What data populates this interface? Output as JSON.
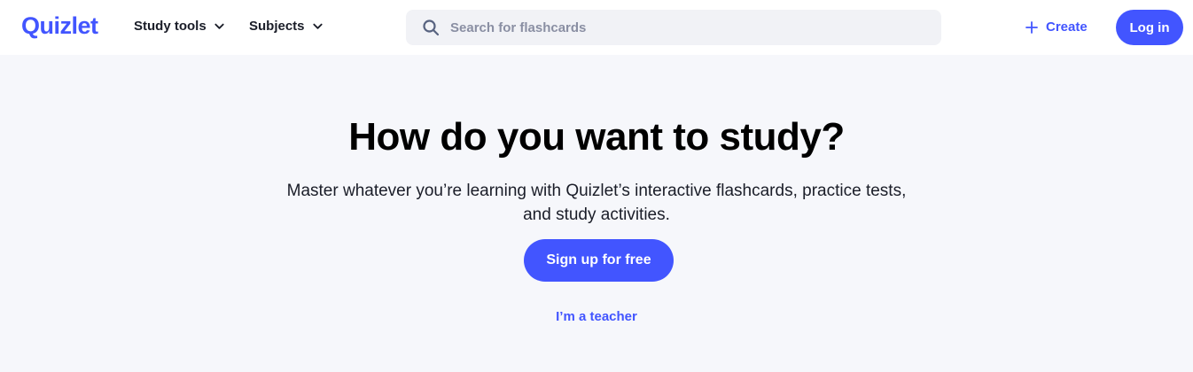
{
  "header": {
    "logo": "Quizlet",
    "nav": [
      {
        "label": "Study tools"
      },
      {
        "label": "Subjects"
      }
    ],
    "search": {
      "placeholder": "Search for flashcards",
      "value": ""
    },
    "create_label": "Create",
    "login_label": "Log in"
  },
  "hero": {
    "title": "How do you want to study?",
    "subtitle_line1": "Master whatever you’re learning with Quizlet’s interactive flashcards, practice tests,",
    "subtitle_line2": "and study activities.",
    "signup_label": "Sign up for free",
    "teacher_link": "I’m a teacher"
  },
  "colors": {
    "brand": "#4255ff",
    "background": "#f6f7fb",
    "header_bg": "#ffffff",
    "search_bg": "#f1f2f6"
  },
  "icons": [
    "chevron-down-icon",
    "search-icon",
    "plus-icon"
  ]
}
